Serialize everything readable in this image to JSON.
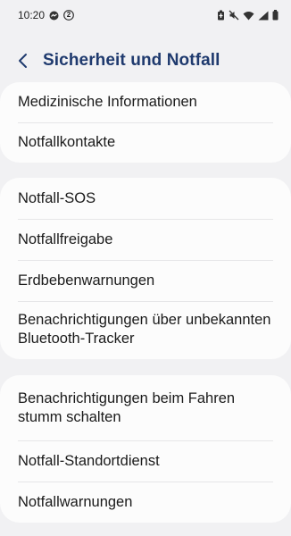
{
  "status_bar": {
    "time": "10:20",
    "left_icons": [
      "messenger-icon",
      "notification-count-icon"
    ],
    "notification_count": "2",
    "right_icons": [
      "battery-saver-icon",
      "mute-icon",
      "wifi-icon",
      "signal-icon",
      "battery-icon"
    ]
  },
  "header": {
    "title": "Sicherheit und Notfall",
    "back_icon": "chevron-left-icon"
  },
  "colors": {
    "background": "#f1f1f3",
    "card": "#fcfcfc",
    "title": "#1f3a6e",
    "divider": "#e6e6e8"
  },
  "groups": [
    {
      "items": [
        {
          "label": "Medizinische Informationen"
        },
        {
          "label": "Notfallkontakte"
        }
      ]
    },
    {
      "items": [
        {
          "label": "Notfall-SOS"
        },
        {
          "label": "Notfallfreigabe"
        },
        {
          "label": "Erdbebenwarnungen"
        },
        {
          "label": "Benachrichtigungen über unbekannten Bluetooth-Tracker"
        }
      ]
    },
    {
      "items": [
        {
          "label": "Benachrichtigungen beim Fahren stumm schalten"
        },
        {
          "label": "Notfall-Standortdienst"
        },
        {
          "label": "Notfallwarnungen"
        }
      ]
    }
  ]
}
